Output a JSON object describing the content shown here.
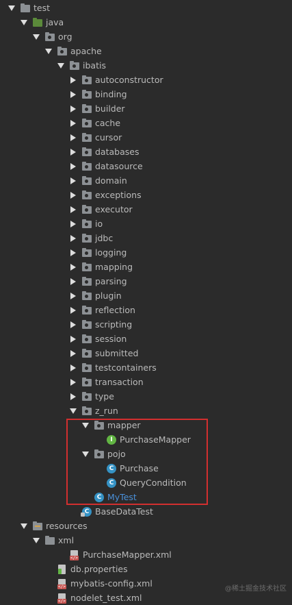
{
  "tree": [
    {
      "label": "test",
      "depth": 0,
      "expand": "down",
      "icon": "folder-icon",
      "kind": "folder"
    },
    {
      "label": "java",
      "depth": 1,
      "expand": "down",
      "icon": "source-folder-icon",
      "kind": "src"
    },
    {
      "label": "org",
      "depth": 2,
      "expand": "down",
      "icon": "package-icon",
      "kind": "pkg"
    },
    {
      "label": "apache",
      "depth": 3,
      "expand": "down",
      "icon": "package-icon",
      "kind": "pkg"
    },
    {
      "label": "ibatis",
      "depth": 4,
      "expand": "down",
      "icon": "package-icon",
      "kind": "pkg"
    },
    {
      "label": "autoconstructor",
      "depth": 5,
      "expand": "right",
      "icon": "package-icon",
      "kind": "pkg"
    },
    {
      "label": "binding",
      "depth": 5,
      "expand": "right",
      "icon": "package-icon",
      "kind": "pkg"
    },
    {
      "label": "builder",
      "depth": 5,
      "expand": "right",
      "icon": "package-icon",
      "kind": "pkg"
    },
    {
      "label": "cache",
      "depth": 5,
      "expand": "right",
      "icon": "package-icon",
      "kind": "pkg"
    },
    {
      "label": "cursor",
      "depth": 5,
      "expand": "right",
      "icon": "package-icon",
      "kind": "pkg"
    },
    {
      "label": "databases",
      "depth": 5,
      "expand": "right",
      "icon": "package-icon",
      "kind": "pkg"
    },
    {
      "label": "datasource",
      "depth": 5,
      "expand": "right",
      "icon": "package-icon",
      "kind": "pkg"
    },
    {
      "label": "domain",
      "depth": 5,
      "expand": "right",
      "icon": "package-icon",
      "kind": "pkg"
    },
    {
      "label": "exceptions",
      "depth": 5,
      "expand": "right",
      "icon": "package-icon",
      "kind": "pkg"
    },
    {
      "label": "executor",
      "depth": 5,
      "expand": "right",
      "icon": "package-icon",
      "kind": "pkg"
    },
    {
      "label": "io",
      "depth": 5,
      "expand": "right",
      "icon": "package-icon",
      "kind": "pkg"
    },
    {
      "label": "jdbc",
      "depth": 5,
      "expand": "right",
      "icon": "package-icon",
      "kind": "pkg"
    },
    {
      "label": "logging",
      "depth": 5,
      "expand": "right",
      "icon": "package-icon",
      "kind": "pkg"
    },
    {
      "label": "mapping",
      "depth": 5,
      "expand": "right",
      "icon": "package-icon",
      "kind": "pkg"
    },
    {
      "label": "parsing",
      "depth": 5,
      "expand": "right",
      "icon": "package-icon",
      "kind": "pkg"
    },
    {
      "label": "plugin",
      "depth": 5,
      "expand": "right",
      "icon": "package-icon",
      "kind": "pkg"
    },
    {
      "label": "reflection",
      "depth": 5,
      "expand": "right",
      "icon": "package-icon",
      "kind": "pkg"
    },
    {
      "label": "scripting",
      "depth": 5,
      "expand": "right",
      "icon": "package-icon",
      "kind": "pkg"
    },
    {
      "label": "session",
      "depth": 5,
      "expand": "right",
      "icon": "package-icon",
      "kind": "pkg"
    },
    {
      "label": "submitted",
      "depth": 5,
      "expand": "right",
      "icon": "package-icon",
      "kind": "pkg"
    },
    {
      "label": "testcontainers",
      "depth": 5,
      "expand": "right",
      "icon": "package-icon",
      "kind": "pkg"
    },
    {
      "label": "transaction",
      "depth": 5,
      "expand": "right",
      "icon": "package-icon",
      "kind": "pkg"
    },
    {
      "label": "type",
      "depth": 5,
      "expand": "right",
      "icon": "package-icon",
      "kind": "pkg"
    },
    {
      "label": "z_run",
      "depth": 5,
      "expand": "down",
      "icon": "package-icon",
      "kind": "pkg"
    },
    {
      "label": "mapper",
      "depth": 6,
      "expand": "down",
      "icon": "package-icon",
      "kind": "pkg"
    },
    {
      "label": "PurchaseMapper",
      "depth": 7,
      "expand": "none",
      "icon": "interface-icon",
      "kind": "iface",
      "glyph": "I"
    },
    {
      "label": "pojo",
      "depth": 6,
      "expand": "down",
      "icon": "package-icon",
      "kind": "pkg"
    },
    {
      "label": "Purchase",
      "depth": 7,
      "expand": "none",
      "icon": "class-icon",
      "kind": "class",
      "glyph": "C"
    },
    {
      "label": "QueryCondition",
      "depth": 7,
      "expand": "none",
      "icon": "class-icon",
      "kind": "class",
      "glyph": "C"
    },
    {
      "label": "MyTest",
      "depth": 6,
      "expand": "none",
      "icon": "class-icon",
      "kind": "class",
      "glyph": "C",
      "blue": true
    },
    {
      "label": "BaseDataTest",
      "depth": 5,
      "expand": "none",
      "icon": "test-class-icon",
      "kind": "testclass",
      "glyph": "C"
    },
    {
      "label": "resources",
      "depth": 1,
      "expand": "down",
      "icon": "resources-folder-icon",
      "kind": "res"
    },
    {
      "label": "xml",
      "depth": 2,
      "expand": "down",
      "icon": "folder-icon",
      "kind": "folder"
    },
    {
      "label": "PurchaseMapper.xml",
      "depth": 4,
      "expand": "none",
      "icon": "xml-file-icon",
      "kind": "xml"
    },
    {
      "label": "db.properties",
      "depth": 3,
      "expand": "none",
      "icon": "properties-file-icon",
      "kind": "props"
    },
    {
      "label": "mybatis-config.xml",
      "depth": 3,
      "expand": "none",
      "icon": "xml-file-icon",
      "kind": "xml"
    },
    {
      "label": "nodelet_test.xml",
      "depth": 3,
      "expand": "none",
      "icon": "xml-file-icon",
      "kind": "xml"
    }
  ],
  "watermark": "@稀土掘金技术社区"
}
